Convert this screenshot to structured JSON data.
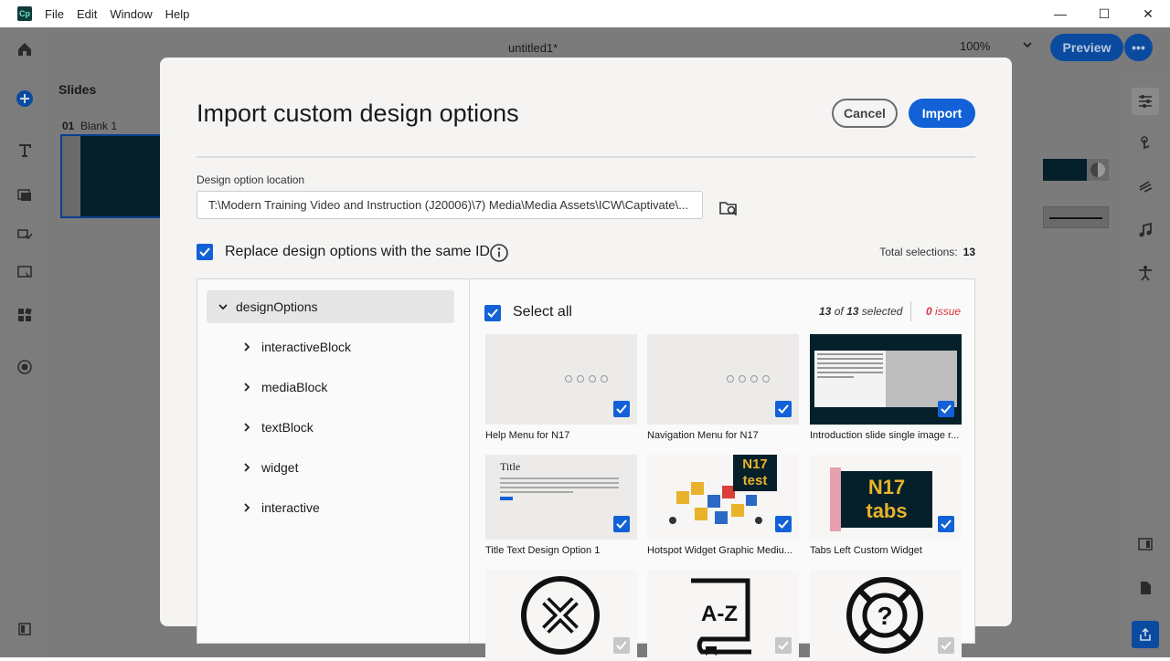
{
  "app": {
    "logo_text": "Cp",
    "menus": [
      "File",
      "Edit",
      "Window",
      "Help"
    ],
    "doc_title": "untitled1*",
    "zoom": "100%",
    "preview_label": "Preview",
    "more_label": "•••"
  },
  "window_controls": {
    "minimize": "—",
    "maximize": "☐",
    "close": "✕"
  },
  "slides": {
    "panel_title": "Slides",
    "items": [
      {
        "number": "01",
        "name": "Blank 1"
      }
    ]
  },
  "dialog": {
    "title": "Import custom design options",
    "cancel_label": "Cancel",
    "import_label": "Import",
    "location_label": "Design option location",
    "location_value": "T:\\Modern Training Video and Instruction (J20006)\\7) Media\\Media Assets\\ICW\\Captivate\\...",
    "replace_label": "Replace design options with the same ID",
    "replace_checked": true,
    "total_label": "Total selections:",
    "total_value": "13",
    "tree": {
      "root": "designOptions",
      "children": [
        "interactiveBlock",
        "mediaBlock",
        "textBlock",
        "widget",
        "interactive"
      ]
    },
    "select_all_label": "Select all",
    "selected_count": "13",
    "selected_of": "of",
    "selected_total": "13",
    "selected_suffix": "selected",
    "issue_count": "0",
    "issue_label": "issue",
    "cards": [
      {
        "caption": "Help Menu for N17",
        "checked": true
      },
      {
        "caption": "Navigation Menu for N17",
        "checked": true
      },
      {
        "caption": "Introduction slide single image r...",
        "checked": true
      },
      {
        "caption": "Title Text Design Option 1",
        "checked": true,
        "thumb_title": "Title"
      },
      {
        "caption": "Hotspot Widget Graphic Mediu...",
        "checked": true,
        "badge": [
          "N17",
          "test"
        ]
      },
      {
        "caption": "Tabs Left Custom Widget",
        "checked": true,
        "badge": [
          "N17",
          "tabs"
        ]
      },
      {
        "caption": "",
        "checked": true,
        "icon": "close-circle-icon"
      },
      {
        "caption": "",
        "checked": true,
        "icon": "glossary-book-icon",
        "icon_text": "A-Z"
      },
      {
        "caption": "",
        "checked": true,
        "icon": "help-lifebuoy-icon"
      }
    ]
  },
  "colors": {
    "accent": "#1261d6",
    "brand_dark": "#05202a",
    "issue": "#d7373f"
  }
}
